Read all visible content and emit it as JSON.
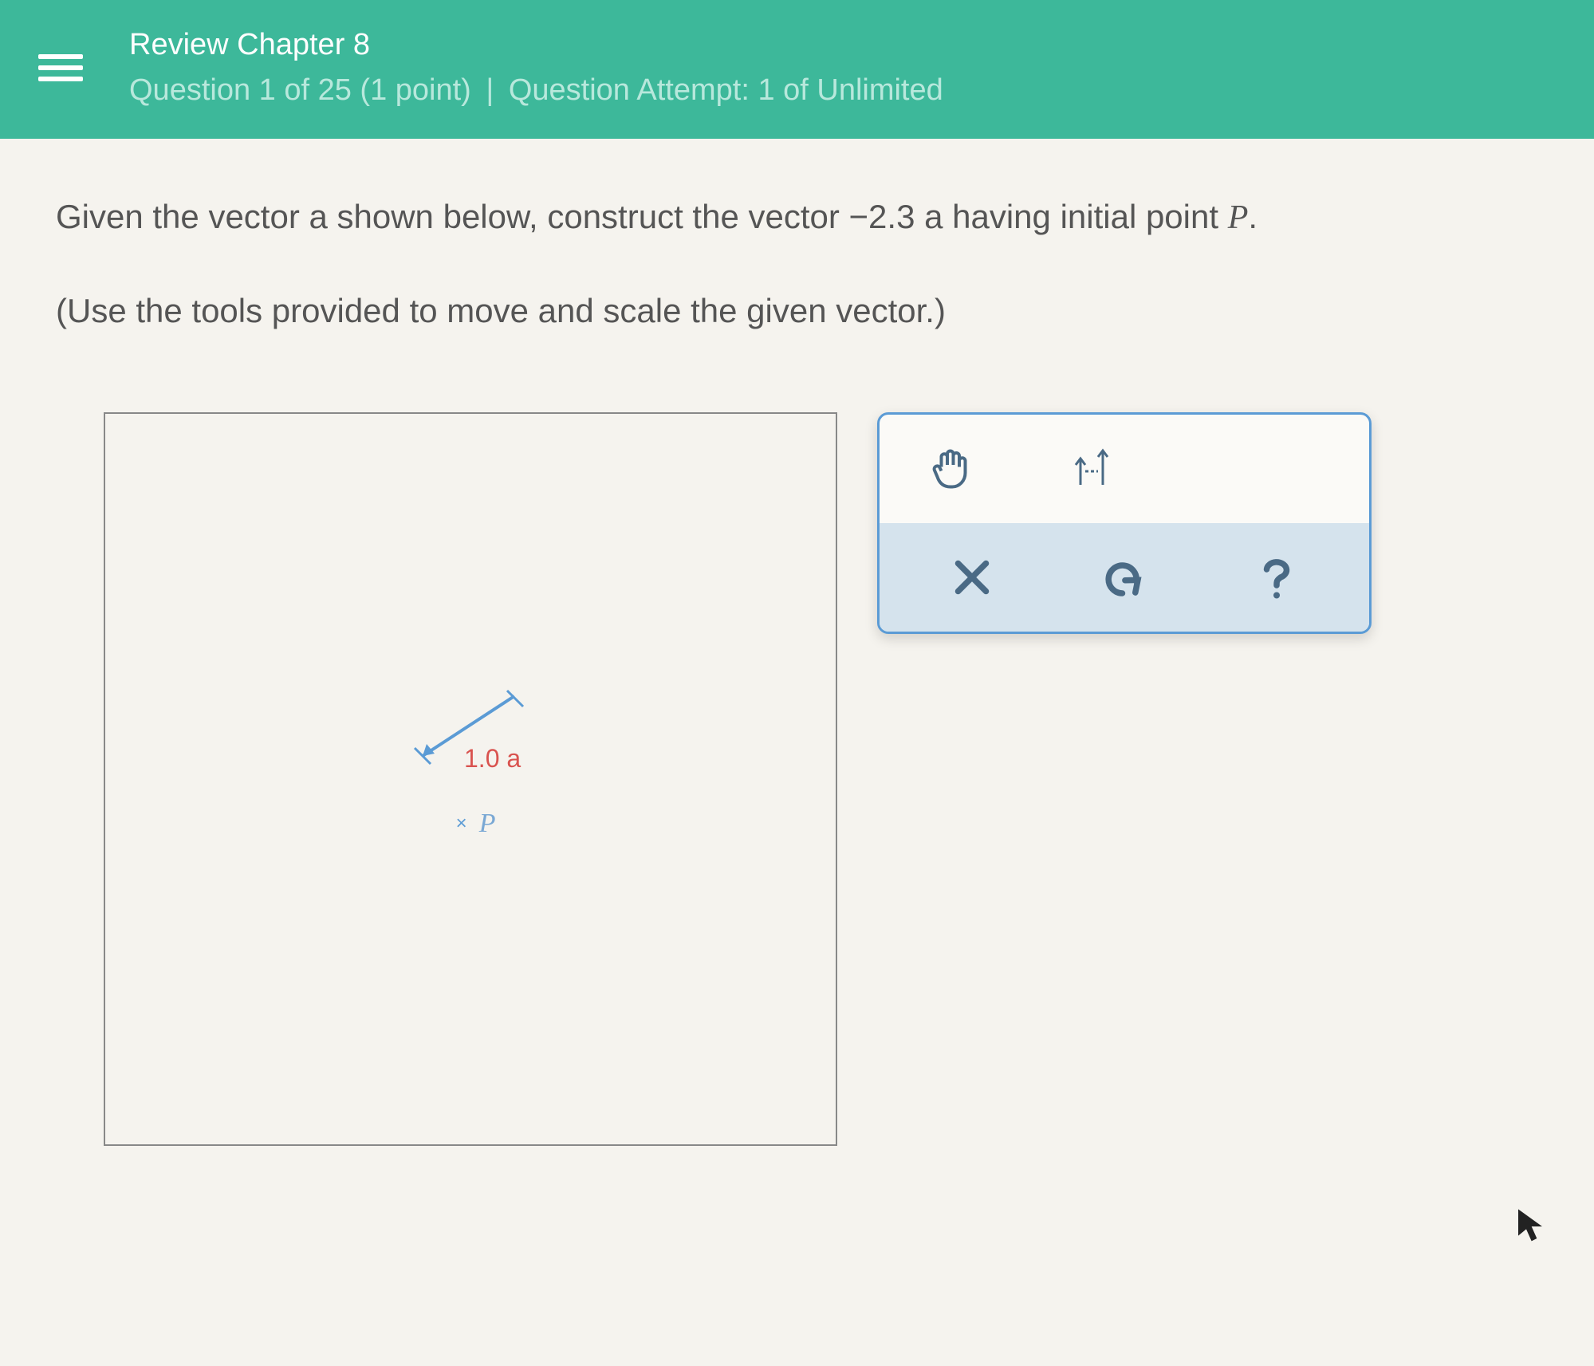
{
  "header": {
    "title": "Review Chapter 8",
    "question_pos": "Question 1 of 25 (1 point)",
    "attempt_label": "Question Attempt: 1 of Unlimited"
  },
  "question": {
    "line1_pre": "Given the vector a shown below, construct the vector ",
    "scalar": "−2.3",
    "line1_post": " a having initial point ",
    "point_var": "P",
    "line1_end": ".",
    "line2": "(Use the tools provided to move and scale the given vector.)"
  },
  "canvas": {
    "vector_label": "1.0 a",
    "point_label": "P"
  },
  "tools": {
    "hand": "hand-move-icon",
    "scale": "scale-arrows-icon",
    "clear": "clear-x-icon",
    "undo": "undo-icon",
    "help": "help-icon"
  }
}
